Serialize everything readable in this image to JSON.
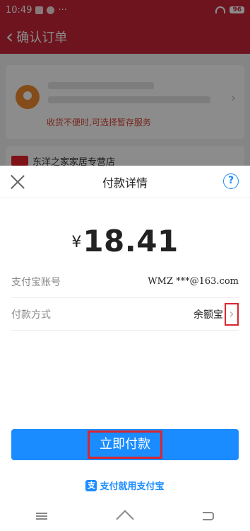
{
  "status_bar": {
    "time": "10:49",
    "battery": "96"
  },
  "header": {
    "back_glyph": "‹",
    "title": "确认订单"
  },
  "address": {
    "notice": "收货不便时,可选择暂存服务",
    "arrow_glyph": "›"
  },
  "shop": {
    "name": "东洋之家家居专营店"
  },
  "payment_sheet": {
    "title": "付款详情",
    "help_glyph": "?",
    "currency": "¥",
    "amount": "18.41",
    "account_label": "支付宝账号",
    "account_value": "WMZ ***@163.com",
    "method_label": "付款方式",
    "method_value": "余额宝",
    "method_arrow_glyph": "›",
    "pay_button_label": "立即付款",
    "brand_text": "支付就用支付宝",
    "brand_logo_glyph": "支"
  },
  "icons": {
    "close": "close-icon",
    "help": "help-icon",
    "location": "location-icon",
    "nav": [
      "menu-icon",
      "home-icon",
      "back-icon"
    ]
  },
  "colors": {
    "header_red": "#c72637",
    "alipay_blue": "#1a8cff",
    "highlight_red": "#d72630",
    "notice_red": "#d9493a"
  }
}
